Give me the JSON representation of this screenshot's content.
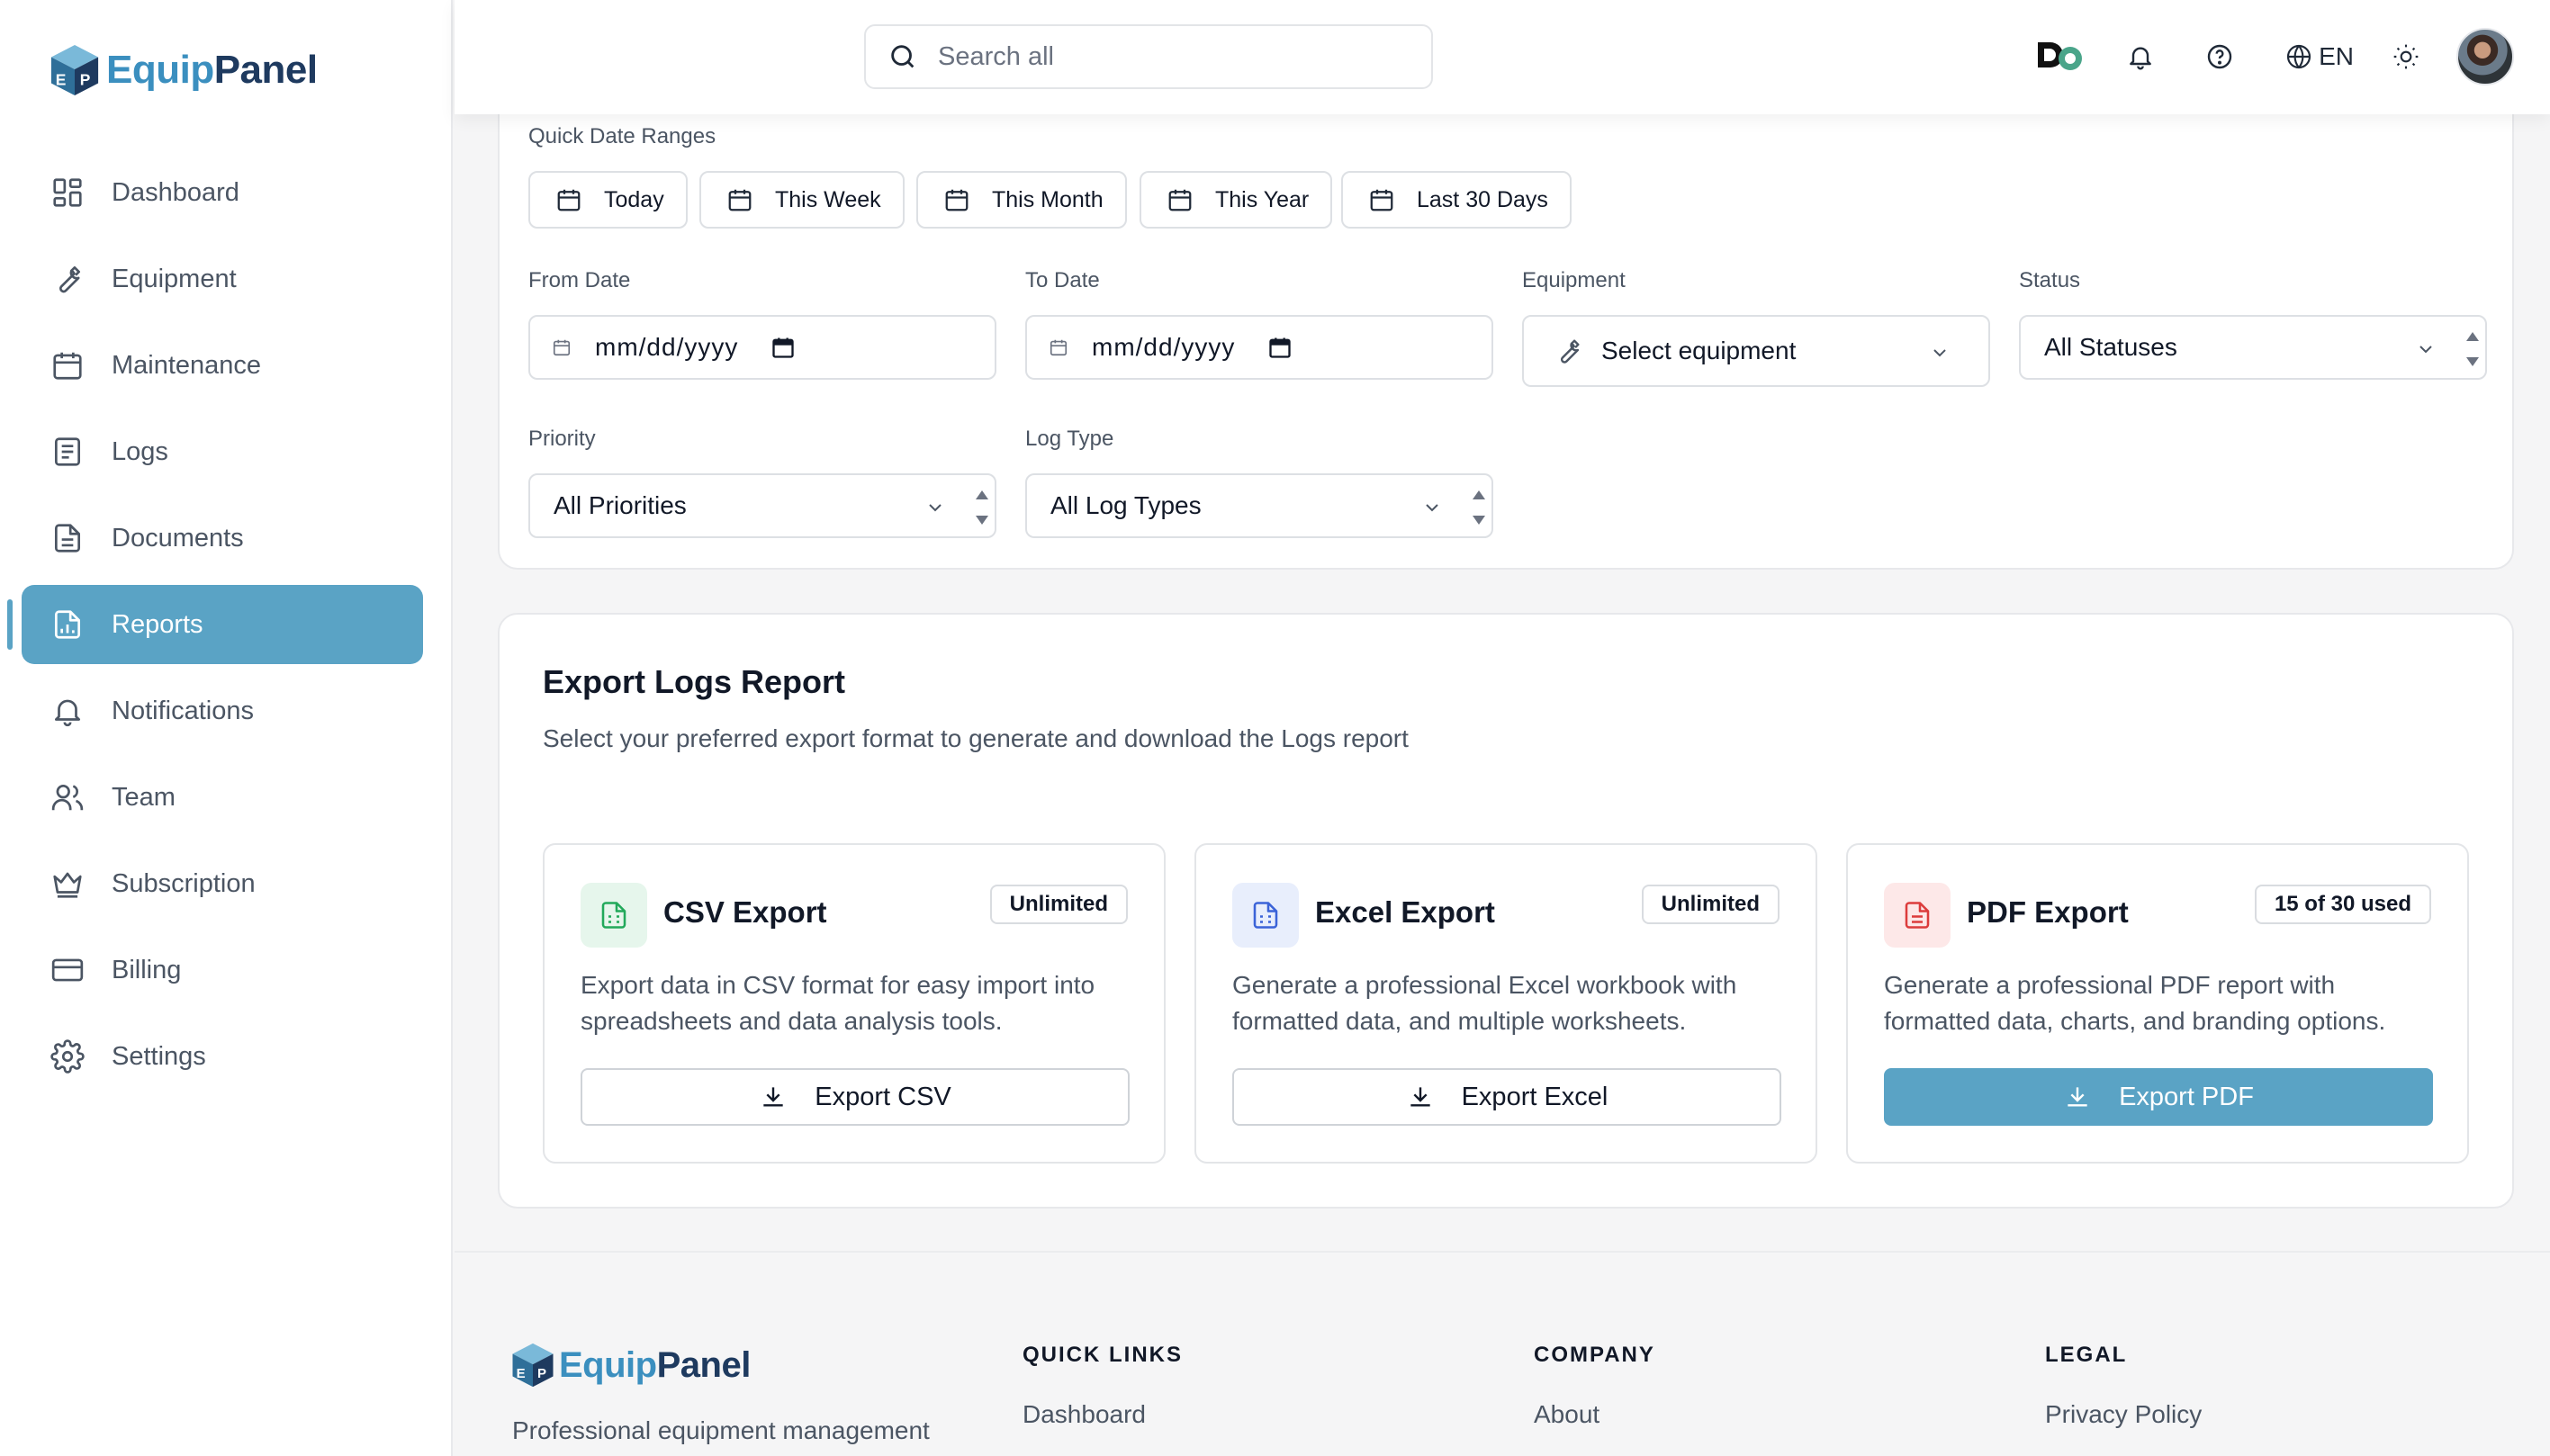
{
  "app": {
    "brand_part1": "Equip",
    "brand_part2": "Panel"
  },
  "sidebar": {
    "items": [
      {
        "label": "Dashboard",
        "icon": "dashboard-icon"
      },
      {
        "label": "Equipment",
        "icon": "wrench-icon"
      },
      {
        "label": "Maintenance",
        "icon": "calendar-icon"
      },
      {
        "label": "Logs",
        "icon": "logs-icon"
      },
      {
        "label": "Documents",
        "icon": "document-icon"
      },
      {
        "label": "Reports",
        "icon": "report-icon",
        "active": true
      },
      {
        "label": "Notifications",
        "icon": "bell-icon"
      },
      {
        "label": "Team",
        "icon": "users-icon"
      },
      {
        "label": "Subscription",
        "icon": "crown-icon"
      },
      {
        "label": "Billing",
        "icon": "credit-card-icon"
      },
      {
        "label": "Settings",
        "icon": "gear-icon"
      }
    ]
  },
  "header": {
    "search_placeholder": "Search all",
    "language": "EN",
    "icons": [
      "do-brand-icon",
      "bell-icon",
      "help-icon",
      "globe-icon",
      "sun-icon",
      "avatar"
    ]
  },
  "filters": {
    "quick_label": "Quick Date Ranges",
    "quick_ranges": [
      "Today",
      "This Week",
      "This Month",
      "This Year",
      "Last 30 Days"
    ],
    "from_label": "From Date",
    "from_value": "mm/dd/yyyy",
    "to_label": "To Date",
    "to_value": "mm/dd/yyyy",
    "equipment_label": "Equipment",
    "equipment_value": "Select equipment",
    "status_label": "Status",
    "status_value": "All Statuses",
    "priority_label": "Priority",
    "priority_value": "All Priorities",
    "logtype_label": "Log Type",
    "logtype_value": "All Log Types"
  },
  "export": {
    "title": "Export Logs Report",
    "subtitle": "Select your preferred export format to generate and download the Logs report",
    "options": [
      {
        "title": "CSV Export",
        "badge": "Unlimited",
        "desc": "Export data in CSV format for easy import into spreadsheets and data analysis tools.",
        "button": "Export CSV",
        "color": "#22a95b"
      },
      {
        "title": "Excel Export",
        "badge": "Unlimited",
        "desc": "Generate a professional Excel workbook with formatted data, and multiple worksheets.",
        "button": "Export Excel",
        "color": "#3b63d8"
      },
      {
        "title": "PDF Export",
        "badge": "15 of 30 used",
        "desc": "Generate a professional PDF report with formatted data, charts, and branding options.",
        "button": "Export PDF",
        "color": "#dc3c3c"
      }
    ]
  },
  "footer": {
    "tagline": "Professional equipment management",
    "columns": [
      {
        "heading": "QUICK LINKS",
        "link": "Dashboard"
      },
      {
        "heading": "COMPANY",
        "link": "About"
      },
      {
        "heading": "LEGAL",
        "link": "Privacy Policy"
      }
    ]
  },
  "colors": {
    "accent": "#5aa3c5",
    "brand_light": "#3b8fbf",
    "brand_dark": "#1e3a5f"
  }
}
